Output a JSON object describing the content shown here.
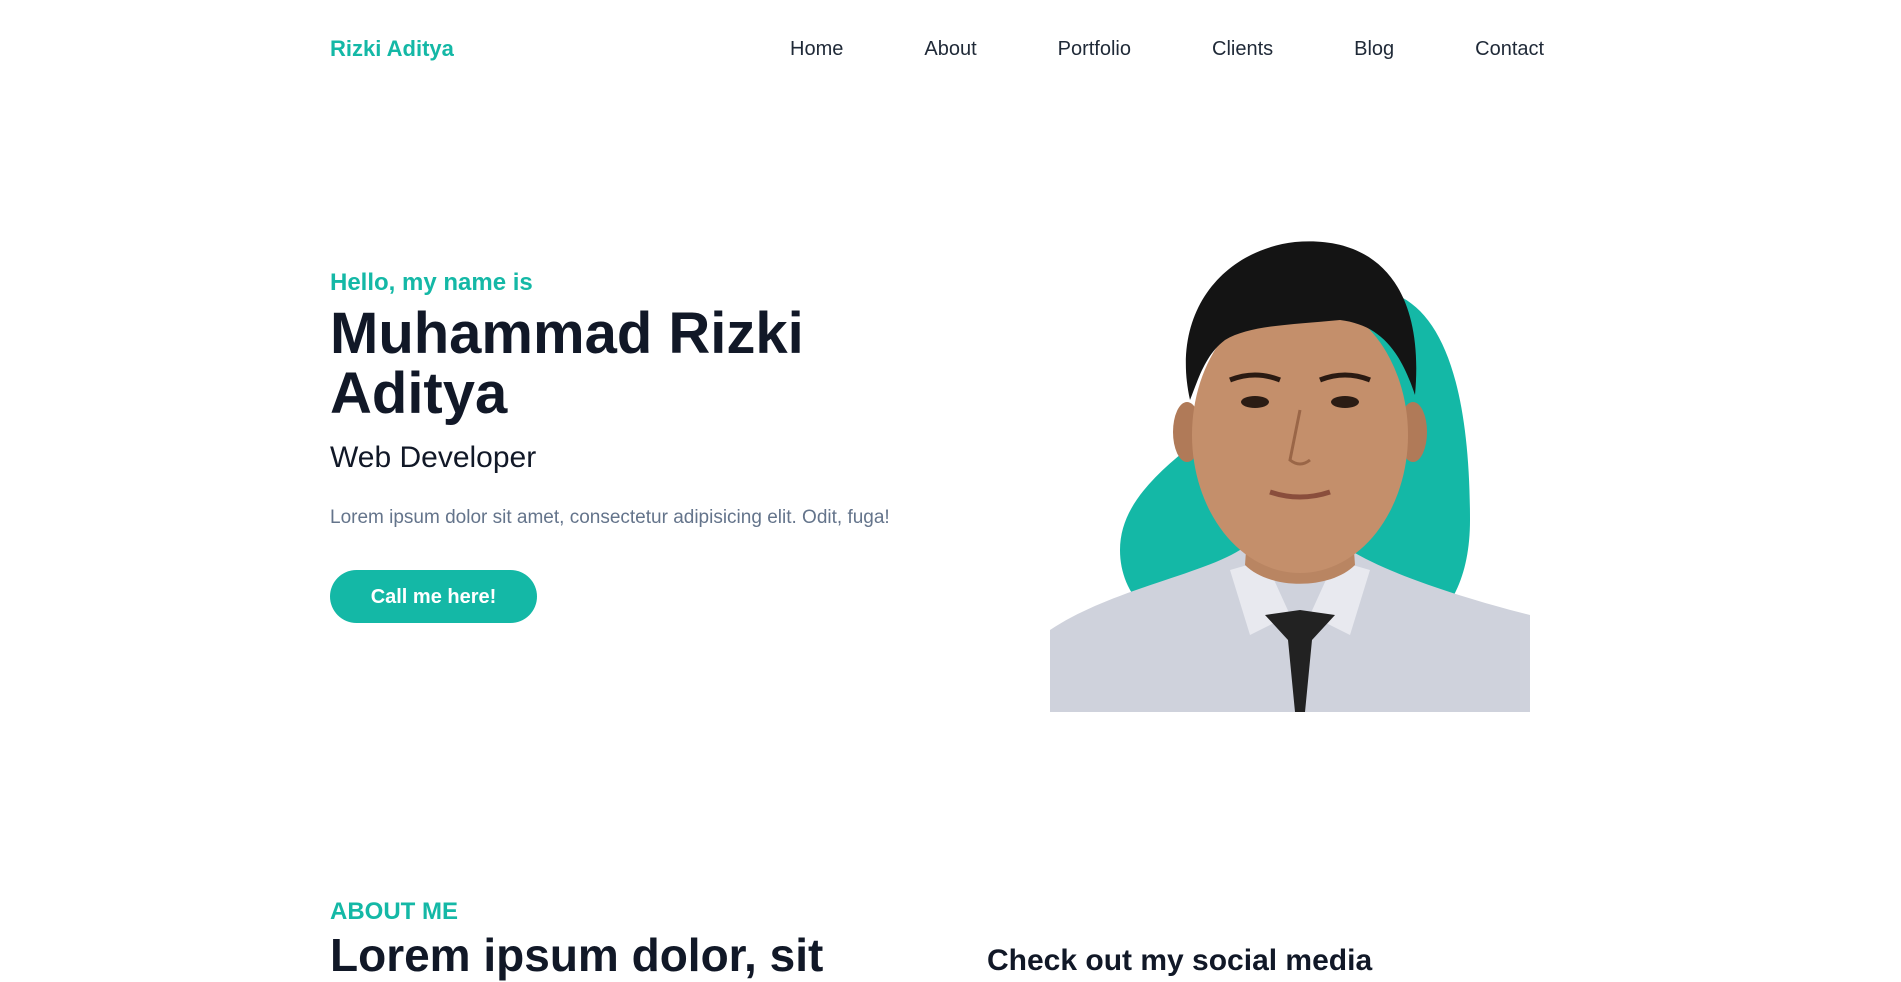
{
  "header": {
    "logo": "Rizki Aditya",
    "nav": [
      "Home",
      "About",
      "Portfolio",
      "Clients",
      "Blog",
      "Contact"
    ]
  },
  "hero": {
    "greeting": "Hello, my name is",
    "name": "Muhammad Rizki Aditya",
    "role": "Web Developer",
    "description": "Lorem ipsum dolor sit amet, consectetur adipisicing elit. Odit, fuga!",
    "cta_label": "Call me here!"
  },
  "about": {
    "label": "ABOUT ME",
    "title": "Lorem ipsum dolor, sit",
    "social_title": "Check out my social media"
  },
  "colors": {
    "accent": "#14b8a6",
    "heading": "#111827",
    "body_text": "#64748b"
  }
}
